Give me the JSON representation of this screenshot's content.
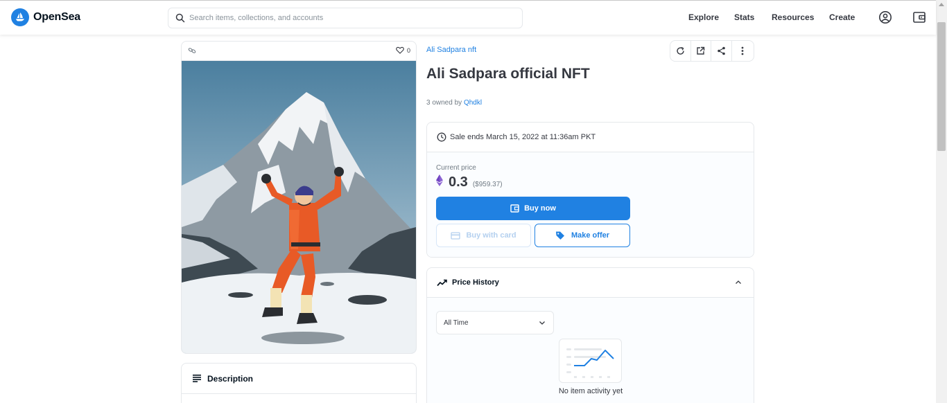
{
  "header": {
    "brand": "OpenSea",
    "search_placeholder": "Search items, collections, and accounts",
    "nav": {
      "explore": "Explore",
      "stats": "Stats",
      "resources": "Resources",
      "create": "Create"
    }
  },
  "asset": {
    "favorites_count": "0",
    "collection": "Ali Sadpara nft",
    "title": "Ali Sadpara official NFT",
    "owned_prefix": "3 owned by ",
    "owner": "Qhdkl"
  },
  "trade": {
    "sale_ends": "Sale ends March 15, 2022 at 11:36am PKT",
    "current_price_label": "Current price",
    "price": "0.3",
    "price_usd": "($959.37)",
    "buy_now_label": "Buy now",
    "buy_with_card_label": "Buy with card",
    "make_offer_label": "Make offer"
  },
  "price_history": {
    "label": "Price History",
    "time_filter": "All Time",
    "empty_message": "No item activity yet"
  },
  "description": {
    "label": "Description"
  },
  "colors": {
    "accent": "#2081e2",
    "text": "#353840",
    "muted": "#707a83",
    "border": "#e5e8eb"
  }
}
